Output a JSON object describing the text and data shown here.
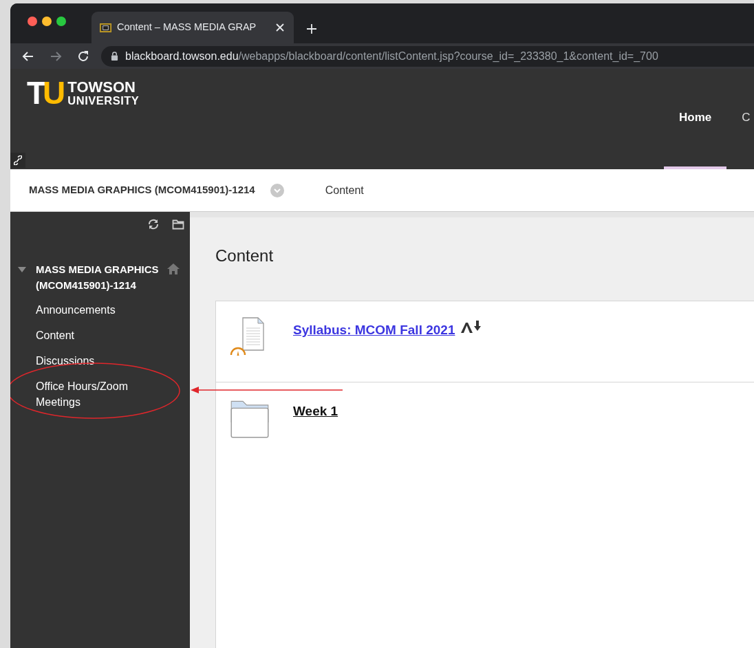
{
  "browser": {
    "tab": {
      "title": "Content – MASS MEDIA GRAP"
    },
    "nav": {
      "forward_disabled": true
    },
    "url": {
      "host": "blackboard.towson.edu",
      "path": "/webapps/blackboard/content/listContent.jsp?course_id=_233380_1&content_id=_700"
    }
  },
  "header": {
    "logo": {
      "mark_left": "T",
      "mark_right": "U",
      "line1": "TOWSON",
      "line2": "UNIVERSITY"
    },
    "nav": [
      {
        "label": "Home",
        "selected": true
      },
      {
        "label": "C",
        "selected": false
      }
    ]
  },
  "breadcrumb": {
    "course": "MASS MEDIA GRAPHICS (MCOM415901)-1214",
    "current": "Content"
  },
  "sidebar": {
    "course": {
      "title": "MASS MEDIA GRAPHICS (MCOM415901)-1214",
      "expanded": true
    },
    "items": [
      {
        "label": "Announcements",
        "circled": false
      },
      {
        "label": "Content",
        "circled": false
      },
      {
        "label": "Discussions",
        "circled": false
      },
      {
        "label": "Office Hours/Zoom Meetings",
        "circled": true
      }
    ]
  },
  "content": {
    "heading": "Content",
    "items": [
      {
        "kind": "file",
        "title": "Syllabus: MCOM Fall 2021"
      },
      {
        "kind": "folder",
        "title": "Week 1"
      }
    ]
  }
}
